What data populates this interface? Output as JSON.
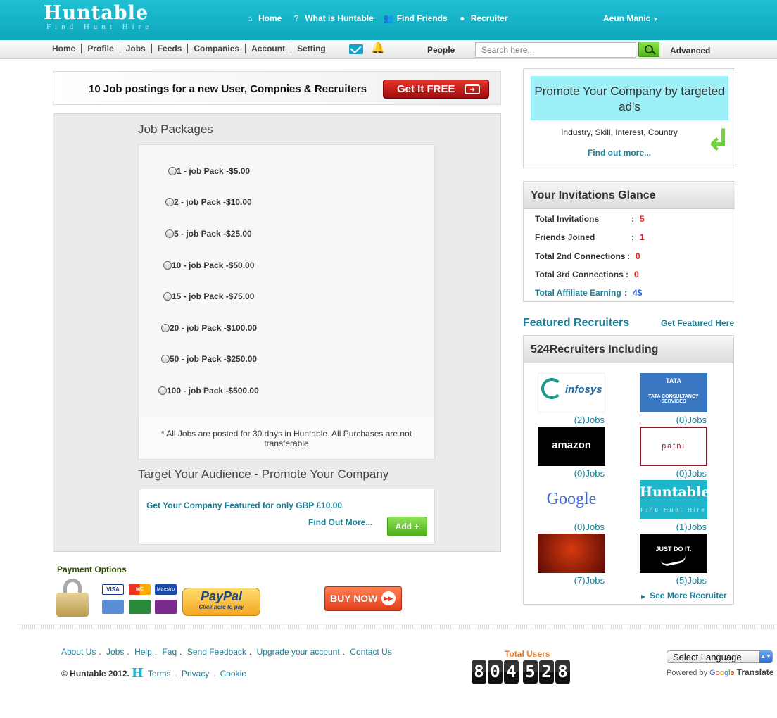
{
  "brand": {
    "name": "Huntable",
    "tagline": "Find Hunt Hire"
  },
  "topnav": [
    {
      "label": "Home",
      "icon": "home-icon"
    },
    {
      "label": "What is Huntable",
      "icon": "question-icon"
    },
    {
      "label": "Find Friends",
      "icon": "people-icon"
    },
    {
      "label": "Recruiter",
      "icon": "person-icon"
    }
  ],
  "user": {
    "name": "Aeun Manic"
  },
  "menu": [
    "Home",
    "Profile",
    "Jobs",
    "Feeds",
    "Companies",
    "Account",
    "Setting"
  ],
  "search": {
    "scope": "People",
    "placeholder": "Search here...",
    "advanced": "Advanced"
  },
  "promo": {
    "text": "10 Job postings for a new User, Compnies & Recruiters",
    "cta": "Get It FREE"
  },
  "job_packages": {
    "title": "Job Packages",
    "options": [
      "1 - job Pack -$5.00",
      "2 - job Pack -$10.00",
      "5 - job Pack -$25.00",
      "10 - job Pack -$50.00",
      "15 - job Pack -$75.00",
      "20 - job Pack -$100.00",
      "50 - job Pack -$250.00",
      "100 - job Pack -$500.00"
    ],
    "note": "* All Jobs are posted for 30 days in Huntable. All Purchases are not transferable"
  },
  "target": {
    "title": "Target Your Audience - Promote Your Company",
    "featured": "Get Your Company Featured for only GBP £10.00",
    "find_more": "Find Out More...",
    "add": "Add +"
  },
  "payment": {
    "title": "Payment Options",
    "paypal_main": "PayPal",
    "paypal_sub": "Click here to pay",
    "buy_now": "BUY NOW",
    "cards": [
      "VISA",
      "MC",
      "Maestro"
    ]
  },
  "ad": {
    "headline": "Promote Your Company by targeted ad's",
    "keywords": "Industry, Skill, Interest, Country",
    "more": "Find out more..."
  },
  "invitations": {
    "title": "Your Invitations Glance",
    "rows": [
      {
        "label": "Total Invitations",
        "value": "5"
      },
      {
        "label": "Friends Joined",
        "value": "1"
      },
      {
        "label": "Total 2nd Connections",
        "value": "0"
      },
      {
        "label": "Total 3rd Connections",
        "value": "0"
      },
      {
        "label": "Total Affiliate Earning",
        "value": "4$"
      }
    ]
  },
  "featured": {
    "title": "Featured Recruiters",
    "link": "Get Featured Here",
    "panel_title": "524Recruiters Including",
    "recruiters": [
      {
        "name": "infosys",
        "jobs": "(2)Jobs"
      },
      {
        "name": "TATA CONSULTANCY SERVICES",
        "jobs": "(0)Jobs"
      },
      {
        "name": "amazon",
        "jobs": "(0)Jobs"
      },
      {
        "name": "patni",
        "jobs": "(0)Jobs"
      },
      {
        "name": "Google",
        "jobs": "(0)Jobs"
      },
      {
        "name": "Huntable",
        "jobs": "(1)Jobs"
      },
      {
        "name": "",
        "jobs": "(7)Jobs"
      },
      {
        "name": "JUST DO IT.",
        "jobs": "(5)Jobs"
      }
    ],
    "see_more": "See More Recruiter"
  },
  "footer": {
    "links": [
      "About Us",
      "Jobs",
      "Help",
      "Faq",
      "Send Feedback",
      "Upgrade your account",
      "Contact Us"
    ],
    "copyright": "© Huntable 2012.",
    "legal": [
      "Terms",
      "Privacy",
      "Cookie"
    ],
    "total_users_label": "Total Users",
    "total_users_digits": [
      "8",
      "0",
      "4",
      "5",
      "2",
      "8"
    ],
    "language": "Select Language",
    "powered_by": "Powered by",
    "translate": "Translate"
  }
}
